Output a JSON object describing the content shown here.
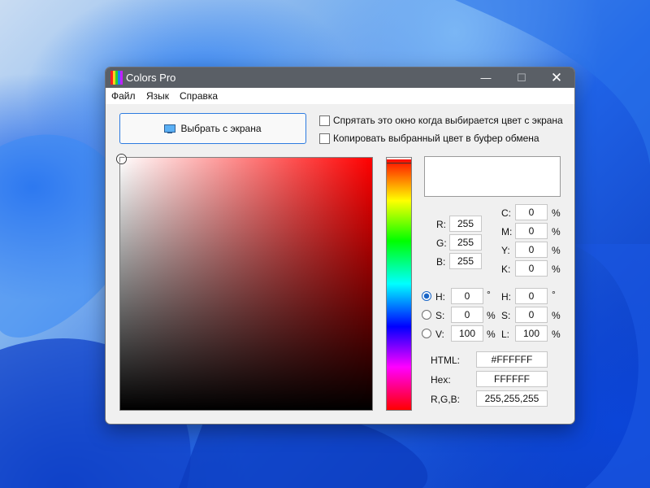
{
  "window": {
    "title": "Colors Pro",
    "minimize_glyph": "—",
    "maximize_glyph": "☐",
    "close_glyph": "✕"
  },
  "menu": [
    "Файл",
    "Язык",
    "Справка"
  ],
  "pick_button": {
    "label": "Выбрать с экрана",
    "icon": "monitor-icon"
  },
  "options": {
    "hide_window": "Спрятать это окно когда выбирается цвет с экрана",
    "copy_to_clipboard": "Копировать выбранный цвет в буфер обмена"
  },
  "preview_color": "#FFFFFF",
  "rgb": {
    "r_label": "R:",
    "r": "255",
    "g_label": "G:",
    "g": "255",
    "b_label": "B:",
    "b": "255"
  },
  "cmyk": {
    "c_label": "C:",
    "c": "0",
    "m_label": "M:",
    "m": "0",
    "y_label": "Y:",
    "y": "0",
    "k_label": "K:",
    "k": "0",
    "unit": "%"
  },
  "hsv": {
    "h_label": "H:",
    "h": "0",
    "s_label": "S:",
    "s": "0",
    "v_label": "V:",
    "v": "100",
    "selected": "H"
  },
  "hsl": {
    "h_label": "H:",
    "h": "0",
    "s_label": "S:",
    "s": "0",
    "l_label": "L:",
    "l": "100"
  },
  "units": {
    "degree": "°",
    "percent": "%"
  },
  "codes": {
    "html_label": "HTML:",
    "html": "#FFFFFF",
    "hex_label": "Hex:",
    "hex": "FFFFFF",
    "rgb_label": "R,G,B:",
    "rgb": "255,255,255"
  }
}
